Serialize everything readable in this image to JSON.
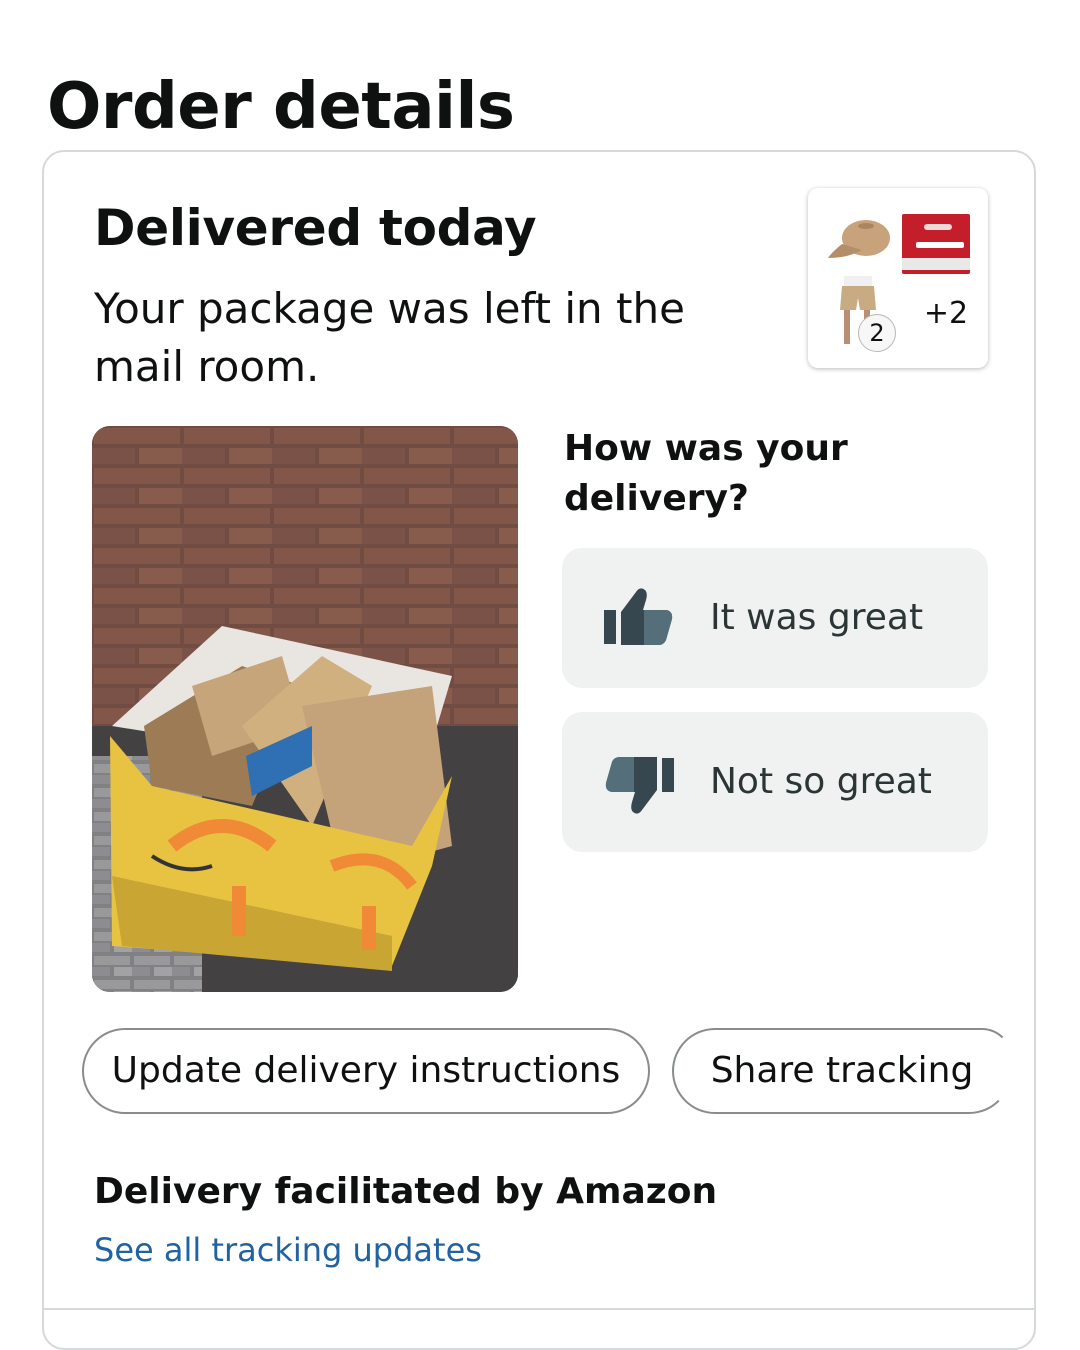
{
  "page": {
    "title": "Order details"
  },
  "delivery": {
    "status_title": "Delivered today",
    "status_message": "Your package was left in the mail room.",
    "items": {
      "thumbnails": [
        "cap-photo",
        "body-spray-4-pack-photo",
        "shorts-photo"
      ],
      "quantity_badge": "2",
      "more_count": "+2"
    },
    "photo": {
      "icon": "delivery-photo"
    }
  },
  "feedback": {
    "question": "How was your delivery?",
    "positive": {
      "label": "It was great",
      "icon": "thumbs-up-icon"
    },
    "negative": {
      "label": "Not so great",
      "icon": "thumbs-down-icon"
    }
  },
  "actions": {
    "update_instructions": "Update delivery instructions",
    "share_tracking": "Share tracking"
  },
  "carrier": {
    "facilitated_by": "Delivery facilitated by Amazon",
    "tracking_link": "See all tracking updates"
  },
  "colors": {
    "link": "#2162a1",
    "rating_button_bg": "#f0f2f2",
    "card_border": "#d5d9d9",
    "icon_fill": "#37474f"
  }
}
